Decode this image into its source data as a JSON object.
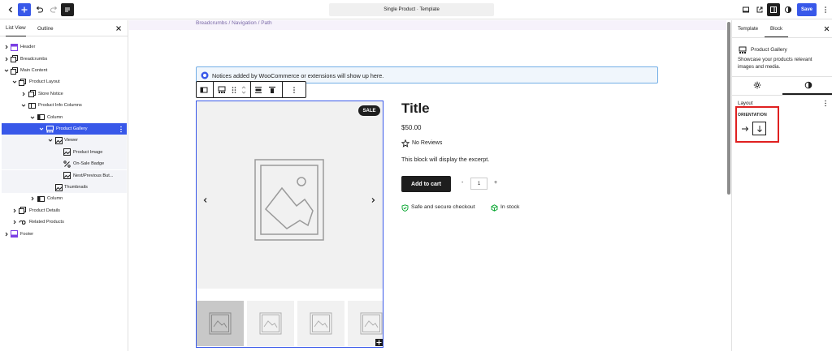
{
  "topbar": {
    "document_title": "Single Product · Template",
    "save_label": "Save"
  },
  "left_panel": {
    "tabs": [
      "List View",
      "Outline"
    ],
    "tree": [
      {
        "label": "Header",
        "level": 0
      },
      {
        "label": "Breadcrumbs",
        "level": 0
      },
      {
        "label": "Main Content",
        "level": 0
      },
      {
        "label": "Product Layout",
        "level": 1
      },
      {
        "label": "Store Notice",
        "level": 2
      },
      {
        "label": "Product Info Columns",
        "level": 2
      },
      {
        "label": "Column",
        "level": 3
      },
      {
        "label": "Product Gallery",
        "level": 4
      },
      {
        "label": "Viewer",
        "level": 5
      },
      {
        "label": "Product Image",
        "level": 6
      },
      {
        "label": "On-Sale Badge",
        "level": 6
      },
      {
        "label": "Next/Previous But...",
        "level": 6
      },
      {
        "label": "Thumbnails",
        "level": 5
      },
      {
        "label": "Column",
        "level": 3
      },
      {
        "label": "Product Details",
        "level": 1
      },
      {
        "label": "Related Products",
        "level": 1
      },
      {
        "label": "Footer",
        "level": 0
      }
    ]
  },
  "canvas": {
    "breadcrumb": "Breadcrumbs / Navigation / Path",
    "notice": "Notices added by WooCommerce or extensions will show up here.",
    "sale_badge": "SALE",
    "product": {
      "title": "Title",
      "price": "$50.00",
      "reviews": "No Reviews",
      "excerpt": "This block will display the excerpt.",
      "add_to_cart": "Add to cart",
      "qty_minus": "-",
      "qty_value": "1",
      "qty_plus": "+",
      "safe_checkout": "Safe and secure checkout",
      "stock": "In stock"
    }
  },
  "right_panel": {
    "tabs": [
      "Template",
      "Block"
    ],
    "block_title": "Product Gallery",
    "block_description": "Showcase your products relevant images and media.",
    "layout_label": "Layout",
    "orientation_label": "ORIENTATION"
  },
  "colors": {
    "accent": "#3858e9",
    "dark": "#1e1e1e",
    "highlight": "#e02020",
    "stock_green": "#00a32a"
  }
}
